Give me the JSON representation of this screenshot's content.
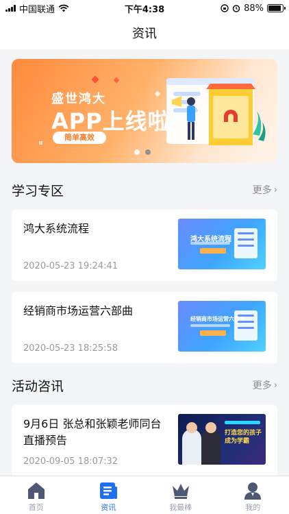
{
  "status_bar": {
    "carrier": "中国联通",
    "time": "下午4:38",
    "battery_percent": 88,
    "battery_text": "88%"
  },
  "nav": {
    "title": "资讯"
  },
  "banner": {
    "title": "盛世鸿大",
    "headline": "APP上线啦!",
    "tag": "简单高效",
    "slides": 2,
    "active_slide": 1
  },
  "sections": [
    {
      "title": "学习专区",
      "more": "更多",
      "items": [
        {
          "title": "鸿大系统流程",
          "date": "2020-05-23 19:24:41",
          "thumb_title": "鸿大系统流程"
        },
        {
          "title": "经销商市场运营六部曲",
          "date": "2020-05-23 18:25:58",
          "thumb_title": "经销商市场运营六部曲"
        }
      ]
    },
    {
      "title": "活动咨讯",
      "more": "更多",
      "items": [
        {
          "title": "9月6日 张总和张颖老师同台直播预告",
          "date": "2020-09-05 18:07:32",
          "thumb_title": "打造您的孩子 成为学霸"
        }
      ]
    }
  ],
  "tabs": [
    {
      "label": "首页",
      "icon": "home-icon",
      "active": false
    },
    {
      "label": "资讯",
      "icon": "news-icon",
      "active": true
    },
    {
      "label": "我最棒",
      "icon": "crown-icon",
      "active": false
    },
    {
      "label": "我的",
      "icon": "profile-icon",
      "active": false
    }
  ],
  "colors": {
    "accent": "#1f6ff2",
    "banner_orange": "#ff8a3d",
    "tab_inactive": "#5b6581"
  }
}
